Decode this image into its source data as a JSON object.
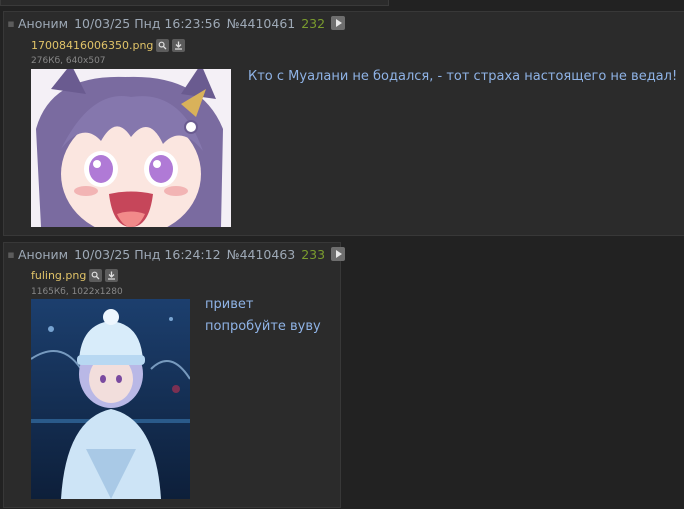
{
  "posts": [
    {
      "author": "Аноним",
      "date": "10/03/25 Пнд 16:23:56",
      "number": "№4410461",
      "count": "232",
      "file": {
        "name": "17008416006350.png",
        "size": "276Кб, 640x507"
      },
      "message": [
        "Кто с Муалани не бодался, - тот страха настоящего не ведал!"
      ]
    },
    {
      "author": "Аноним",
      "date": "10/03/25 Пнд 16:24:12",
      "number": "№4410463",
      "count": "233",
      "file": {
        "name": "fuling.png",
        "size": "1165Кб, 1022x1280"
      },
      "message": [
        "привет",
        "попробуйте вуву"
      ]
    }
  ],
  "colors": {
    "background": "#222222",
    "post_bg": "#2b2b2b",
    "name": "#9ea9b6",
    "file_name": "#e0c368",
    "post_count": "#7a9c2e",
    "message_text": "#8fb3e6"
  },
  "icons": {
    "post_arrow": "post-arrow-icon",
    "play": "play-icon",
    "search": "search-icon",
    "download": "download-icon"
  }
}
